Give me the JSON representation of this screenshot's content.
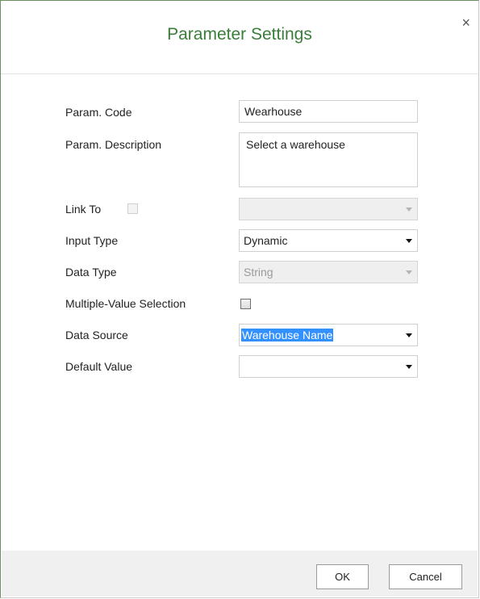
{
  "dialog": {
    "title": "Parameter Settings",
    "close_symbol": "×"
  },
  "form": {
    "param_code": {
      "label": "Param. Code",
      "value": "Wearhouse"
    },
    "param_description": {
      "label": "Param. Description",
      "value": "Select a warehouse"
    },
    "link_to": {
      "label": "Link To",
      "checked": false,
      "value": ""
    },
    "input_type": {
      "label": "Input Type",
      "value": "Dynamic"
    },
    "data_type": {
      "label": "Data Type",
      "value": "String"
    },
    "multiple_value": {
      "label": "Multiple-Value Selection",
      "checked": false
    },
    "data_source": {
      "label": "Data Source",
      "value": "Warehouse Name"
    },
    "default_value": {
      "label": "Default Value",
      "value": ""
    }
  },
  "footer": {
    "ok_label": "OK",
    "cancel_label": "Cancel"
  }
}
